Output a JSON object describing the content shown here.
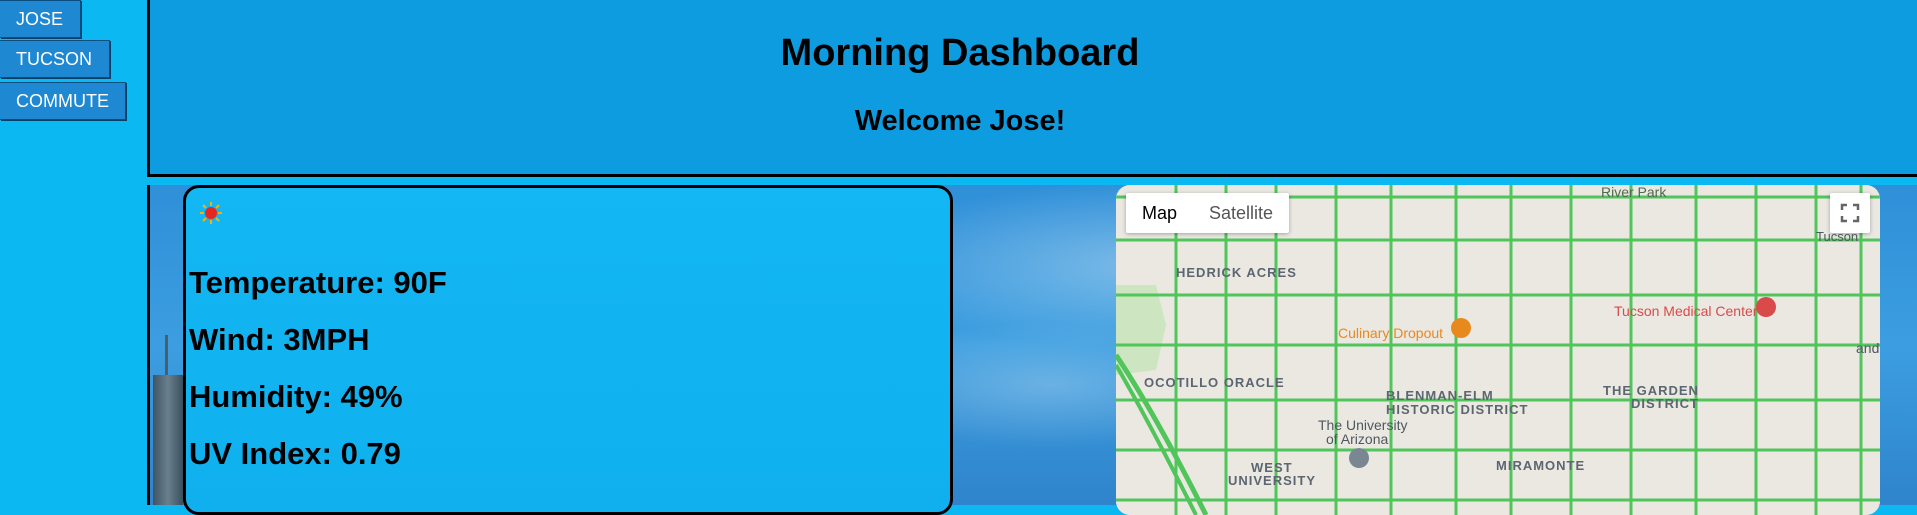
{
  "nav": {
    "items": [
      {
        "label": "JOSE"
      },
      {
        "label": "TUCSON"
      },
      {
        "label": "COMMUTE"
      }
    ]
  },
  "header": {
    "title": "Morning Dashboard",
    "welcome": "Welcome Jose!"
  },
  "weather": {
    "icon": "sun-icon",
    "temperature": "Temperature: 90F",
    "wind": "Wind: 3MPH",
    "humidity": "Humidity: 49%",
    "uv": "UV Index: 0.79"
  },
  "map": {
    "type_buttons": [
      "Map",
      "Satellite"
    ],
    "labels": {
      "river_park": "River Park",
      "hedrick": "HEDRICK ACRES",
      "ocotillo": "OCOTILLO ORACLE",
      "blenman": "BLENMAN-ELM",
      "historic": "HISTORIC DISTRICT",
      "garden": "THE GARDEN",
      "garden2": "DISTRICT",
      "university": "The University",
      "university2": "of Arizona",
      "west": "WEST",
      "west2": "UNIVERSITY",
      "miramonte": "MIRAMONTE",
      "culinary": "Culinary Dropout",
      "medical": "Tucson Medical Center",
      "tucson": "Tucson",
      "and": "and"
    },
    "colors": {
      "road_traffic": "#4fc55a",
      "poi_orange": "#e8891d",
      "poi_red": "#d94a4a"
    }
  }
}
